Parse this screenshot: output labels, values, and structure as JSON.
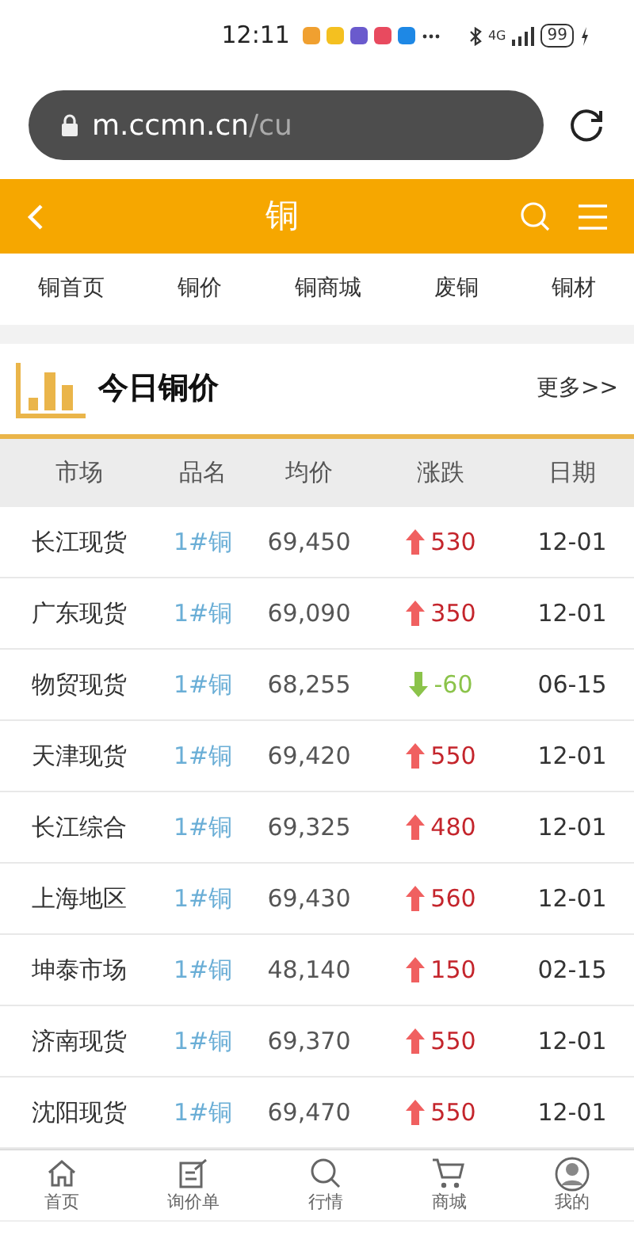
{
  "status_bar": {
    "time": "12:11",
    "network": "4G",
    "battery": "99"
  },
  "address_bar": {
    "domain": "m.ccmn.cn",
    "path": "/cu"
  },
  "header": {
    "title": "铜"
  },
  "subnav": [
    "铜首页",
    "铜价",
    "铜商城",
    "废铜",
    "铜材"
  ],
  "section": {
    "title": "今日铜价",
    "more": "更多>>"
  },
  "table": {
    "columns": [
      "市场",
      "品名",
      "均价",
      "涨跌",
      "日期"
    ],
    "rows": [
      {
        "market": "长江现货",
        "product": "1#铜",
        "price": "69,450",
        "change": "530",
        "rising": true,
        "date": "12-01"
      },
      {
        "market": "广东现货",
        "product": "1#铜",
        "price": "69,090",
        "change": "350",
        "rising": true,
        "date": "12-01"
      },
      {
        "market": "物贸现货",
        "product": "1#铜",
        "price": "68,255",
        "change": "-60",
        "rising": false,
        "date": "06-15"
      },
      {
        "market": "天津现货",
        "product": "1#铜",
        "price": "69,420",
        "change": "550",
        "rising": true,
        "date": "12-01"
      },
      {
        "market": "长江综合",
        "product": "1#铜",
        "price": "69,325",
        "change": "480",
        "rising": true,
        "date": "12-01"
      },
      {
        "market": "上海地区",
        "product": "1#铜",
        "price": "69,430",
        "change": "560",
        "rising": true,
        "date": "12-01"
      },
      {
        "market": "坤泰市场",
        "product": "1#铜",
        "price": "48,140",
        "change": "150",
        "rising": true,
        "date": "02-15"
      },
      {
        "market": "济南现货",
        "product": "1#铜",
        "price": "69,370",
        "change": "550",
        "rising": true,
        "date": "12-01"
      },
      {
        "market": "沈阳现货",
        "product": "1#铜",
        "price": "69,470",
        "change": "550",
        "rising": true,
        "date": "12-01"
      }
    ]
  },
  "bottom_nav": [
    {
      "label": "首页",
      "kind": "home"
    },
    {
      "label": "询价单",
      "kind": "inquiry"
    },
    {
      "label": "行情",
      "kind": "search"
    },
    {
      "label": "商城",
      "kind": "cart"
    },
    {
      "label": "我的",
      "kind": "user"
    }
  ]
}
